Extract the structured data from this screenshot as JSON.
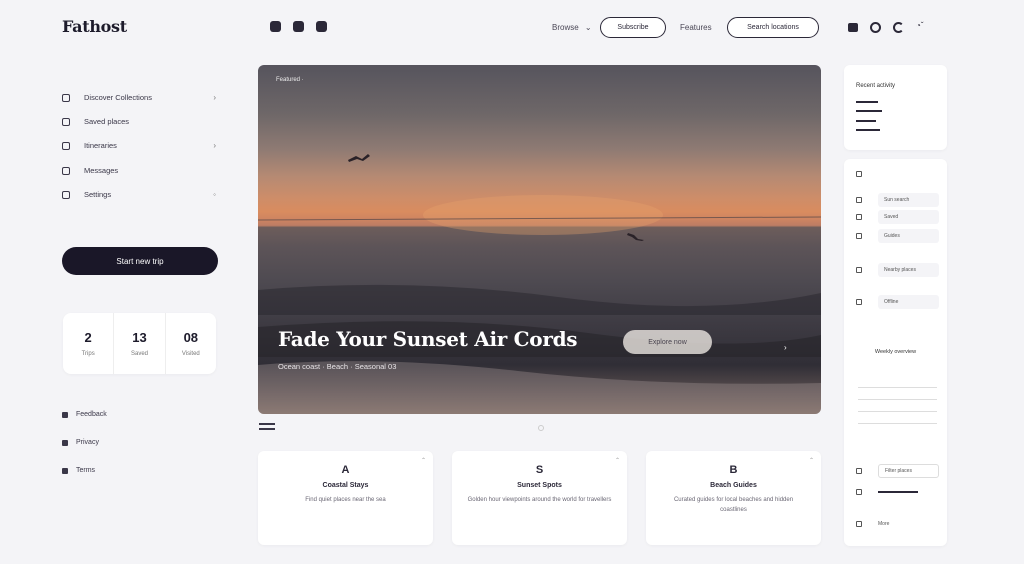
{
  "header": {
    "logo": "Fathost",
    "nav_link_1": "Browse",
    "nav_pill_1": "Subscribe",
    "nav_link_2": "Features",
    "nav_pill_2": "Search locations"
  },
  "sidebar": {
    "items": [
      {
        "label": "Discover Collections",
        "icon": "grid-icon",
        "chevron": "›"
      },
      {
        "label": "Saved places",
        "icon": "bookmark-icon",
        "chevron": ""
      },
      {
        "label": "Itineraries",
        "icon": "map-icon",
        "chevron": "›"
      },
      {
        "label": "Messages",
        "icon": "chat-icon",
        "chevron": ""
      },
      {
        "label": "Settings",
        "icon": "gear-icon",
        "chevron": "◦"
      }
    ],
    "cta_label": "Start new trip",
    "stats": [
      {
        "num": "2",
        "label": "Trips"
      },
      {
        "num": "13",
        "label": "Saved"
      },
      {
        "num": "08",
        "label": "Visited"
      }
    ],
    "footer_links": [
      "Feedback",
      "Privacy",
      "Terms"
    ]
  },
  "hero": {
    "tag": "Featured ·",
    "title": "Fade Your Sunset Air Cords",
    "subtitle": "Ocean coast · Beach · Seasonal 03",
    "button_label": "Explore now",
    "arrow": "›"
  },
  "cards": [
    {
      "icon": "A",
      "title": "Coastal Stays",
      "body": "Find quiet places near the sea"
    },
    {
      "icon": "S",
      "title": "Sunset Spots",
      "body": "Golden hour viewpoints around the world for travellers"
    },
    {
      "icon": "B",
      "title": "Beach Guides",
      "body": "Curated guides for local beaches and hidden coastlines"
    }
  ],
  "right_panel": {
    "top_title": "Recent activity",
    "rows": [
      "Sun search",
      "Saved",
      "Guides",
      "Nearby places",
      "Offline"
    ],
    "section_title": "Weekly overview",
    "input_label": "Filter places",
    "nav_label": "More"
  },
  "colors": {
    "accent": "#1a1728",
    "background": "#f4f4f7",
    "card": "#ffffff"
  }
}
